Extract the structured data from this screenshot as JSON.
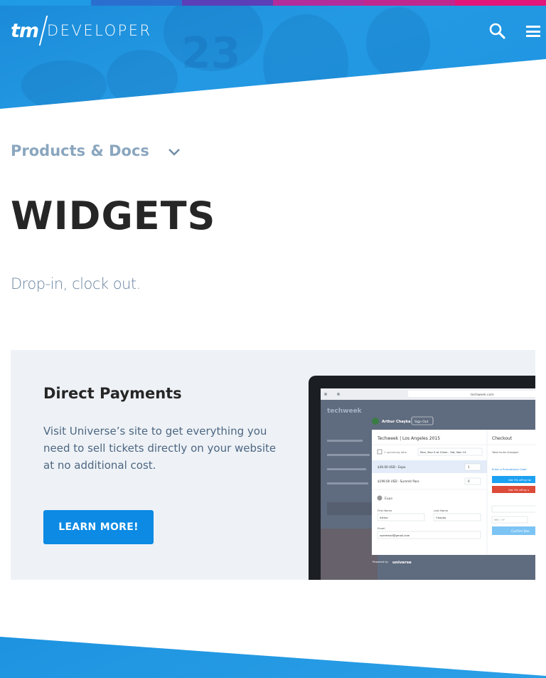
{
  "colors": {
    "strip": [
      "#1f9ae5",
      "#2a6fd0",
      "#5a3fb8",
      "#b22c9c",
      "#c0288f",
      "#e2157a"
    ],
    "hero_blue": "#1f95e2",
    "accent": "#0c8ae4"
  },
  "header": {
    "logo_tm": "tm",
    "logo_developer": "DEVELOPER",
    "search_icon": "search-icon",
    "menu_icon": "hamburger-menu-icon"
  },
  "nav": {
    "products_label": "Products & Docs",
    "chevron_icon": "chevron-down-icon"
  },
  "page": {
    "title": "WIDGETS",
    "tagline": "Drop-in, clock out."
  },
  "card": {
    "title": "Direct Payments",
    "text": "Visit Universe’s site to get everything you need to sell tickets directly on your website at no additional cost.",
    "button_label": "LEARN MORE!"
  },
  "screenshot": {
    "url": "techweek.com",
    "brand": "techweek",
    "user": "Arthur Chayka",
    "sign_out": "Sign Out",
    "event": "Techweek | Los Angeles 2015",
    "checkout": "Checkout",
    "dates_label": "1 upcoming date",
    "dates_value": "Mon, Nov 9 at 10am - Sat, Nov 14",
    "ticket1": "$30.00 USD - Expo",
    "ticket1_qty": "1",
    "ticket2": "$199.00 USD - Summit Pass",
    "ticket2_qty": "0",
    "expo": "Expo",
    "first_name_label": "First Name",
    "first_name": "Arthur",
    "last_name_label": "Last Name",
    "last_name": "Chayka",
    "email_label": "Email",
    "email": "useremail@gmail.com",
    "total": "Total to be charged:",
    "promo": "Enter a Promotional Code",
    "share1": "Get 3% off by tw",
    "share2": "Get 3% off by s",
    "mmyy": "MM / YY",
    "confirm": "Confirm Boo",
    "powered": "Powered by",
    "universe": "universe"
  }
}
